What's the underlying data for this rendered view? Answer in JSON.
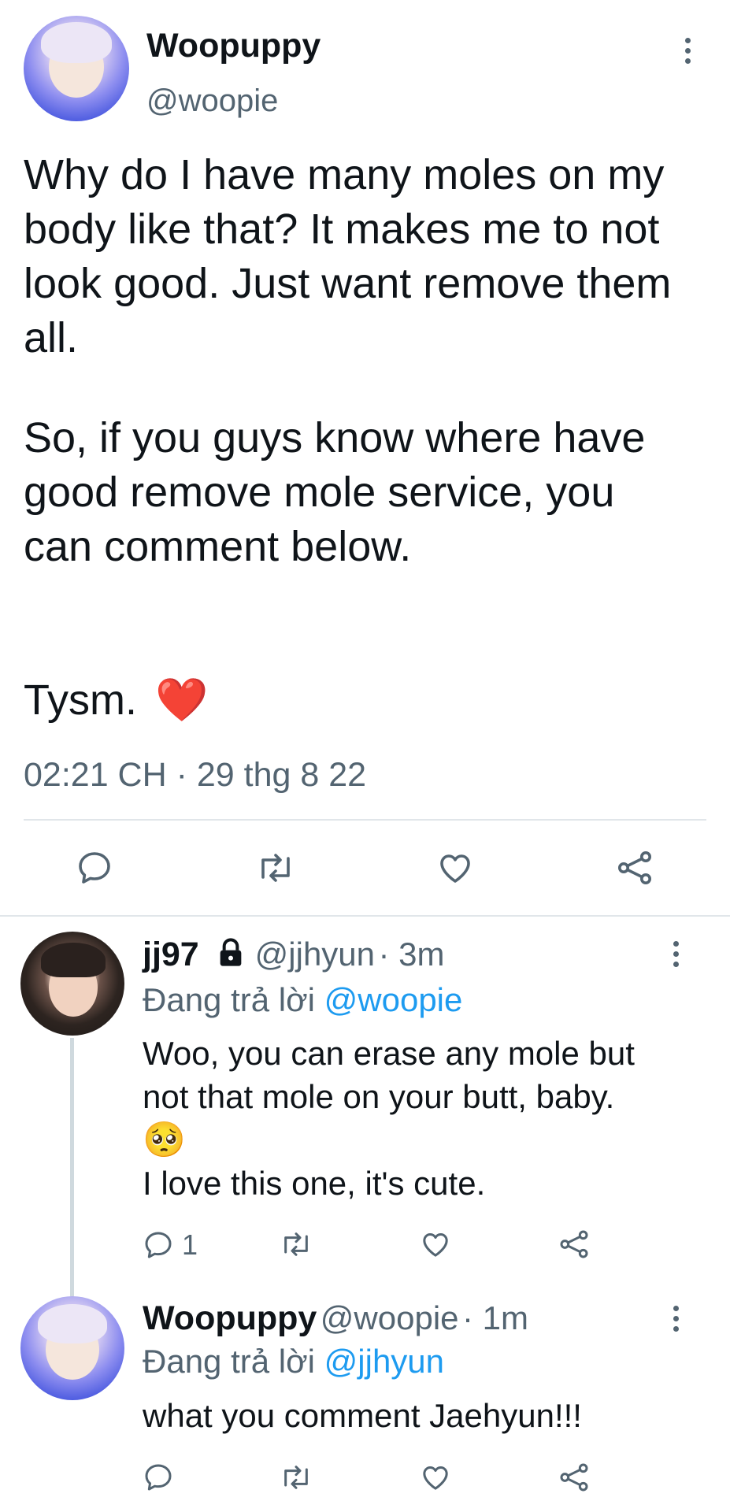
{
  "main_tweet": {
    "display_name": "Woopuppy",
    "handle": "@woopie",
    "text_p1": "Why do I have many moles on my body like that? It makes me to not look good. Just want remove them all.",
    "text_p2": "So, if you guys know where have good remove mole service, you can comment below.",
    "text_p3": "Tysm.",
    "emoji": "❤️",
    "timestamp": "02:21 CH · 29 thg 8 22"
  },
  "replies": [
    {
      "display_name": "jj97",
      "handle": "@jjhyun",
      "time": "· 3m",
      "replying_prefix": "Đang trả lời",
      "replying_to": "@woopie",
      "text_line1": "Woo, you can erase any mole but",
      "text_line2": "not that mole on your butt, baby.",
      "emoji": "🥺",
      "text_line3": "I love this one, it's cute.",
      "reply_count": "1"
    },
    {
      "display_name": "Woopuppy",
      "handle": "@woopie",
      "time": "· 1m",
      "replying_prefix": "Đang trả lời",
      "replying_to": "@jjhyun",
      "text_line1": "what you comment Jaehyun!!!"
    }
  ],
  "icons": [
    "reply-icon",
    "retweet-icon",
    "like-icon",
    "share-icon",
    "more-icon",
    "lock-icon"
  ],
  "colors": {
    "link": "#1d9bf0",
    "secondary": "#536471",
    "text": "#0f1419",
    "divider": "#e1e6ea"
  }
}
